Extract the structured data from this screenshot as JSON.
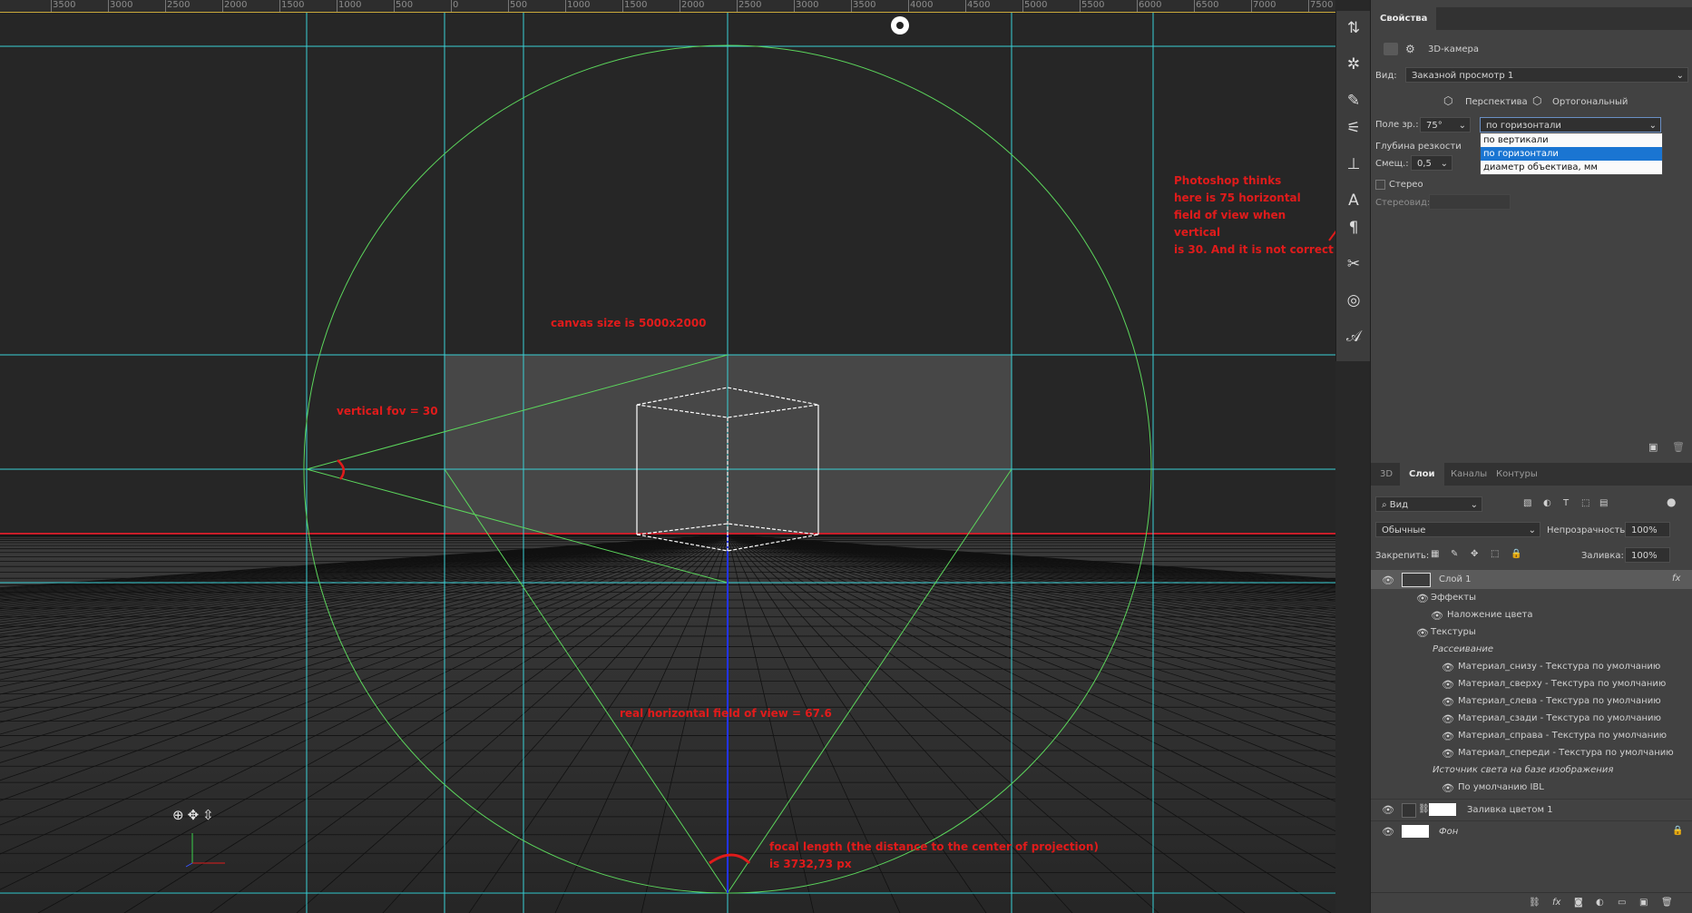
{
  "ruler": {
    "ticks": [
      "3500",
      "3000",
      "2500",
      "2000",
      "1500",
      "1000",
      "500",
      "0",
      "500",
      "1000",
      "1500",
      "2000",
      "2500",
      "3000",
      "3500",
      "4000",
      "4500",
      "5000",
      "5500",
      "6000",
      "6500",
      "7000",
      "7500"
    ]
  },
  "annotations": {
    "photoshop_thinks": "Photoshop thinks\nhere is 75 horizontal\nfield of view when vertical\nis 30. And it is not correct",
    "canvas_size": "canvas size is 5000x2000",
    "vertical_fov": "vertical fov = 30",
    "real_fov": "real horizontal field of view = 67.6",
    "focal_length": "focal length (the distance to the center of projection)\nis 3732,73 px"
  },
  "properties": {
    "tab_label": "Свойства",
    "camera_label": "3D-камера",
    "view_label": "Вид:",
    "view_value": "Заказной просмотр 1",
    "perspective_label": "Перспектива",
    "orthographic_label": "Ортогональный",
    "fov_label": "Поле зр.:",
    "fov_value": "75°",
    "fov_mode_value": "по горизонтали",
    "dropdown_options": [
      "по вертикали",
      "по горизонтали",
      "диаметр объектива, мм"
    ],
    "dropdown_selected": "по горизонтали",
    "dof_label": "Глубина резкости",
    "offset_label": "Смещ.:",
    "offset_value": "0,5",
    "stereo_label": "Стерео",
    "stereo_type_label": "Стереовид:"
  },
  "layers_panel": {
    "tabs": [
      "3D",
      "Слои",
      "Каналы",
      "Контуры"
    ],
    "active_tab": "Слои",
    "filter_value": "Вид",
    "blend_mode": "Обычные",
    "opacity_label": "Непрозрачность:",
    "opacity_value": "100%",
    "lock_label": "Закрепить:",
    "fill_label": "Заливка:",
    "fill_value": "100%",
    "layer1_name": "Слой 1",
    "effects_label": "Эффекты",
    "color_overlay_label": "Наложение цвета",
    "textures_label": "Текстуры",
    "diffuse_label": "Рассеивание",
    "materials": [
      "Материал_снизу - Текстура по умолчанию",
      "Материал_сверху - Текстура по умолчанию",
      "Материал_слева - Текстура по умолчанию",
      "Материал_сзади - Текстура по умолчанию",
      "Материал_справа - Текстура по умолчанию",
      "Материал_спереди - Текстура по умолчанию"
    ],
    "ibl_label": "Источник света на базе изображения",
    "ibl_default": "По умолчанию IBL",
    "fill_layer_name": "Заливка цветом 1",
    "background_name": "Фон"
  },
  "colors": {
    "guide": "#3ad0d6",
    "construction": "#5cd65c",
    "annotation": "#e01b1b",
    "horizon_red": "#c81e2a",
    "center_blue": "#2233ff",
    "selection_blue": "#1a75d2"
  }
}
